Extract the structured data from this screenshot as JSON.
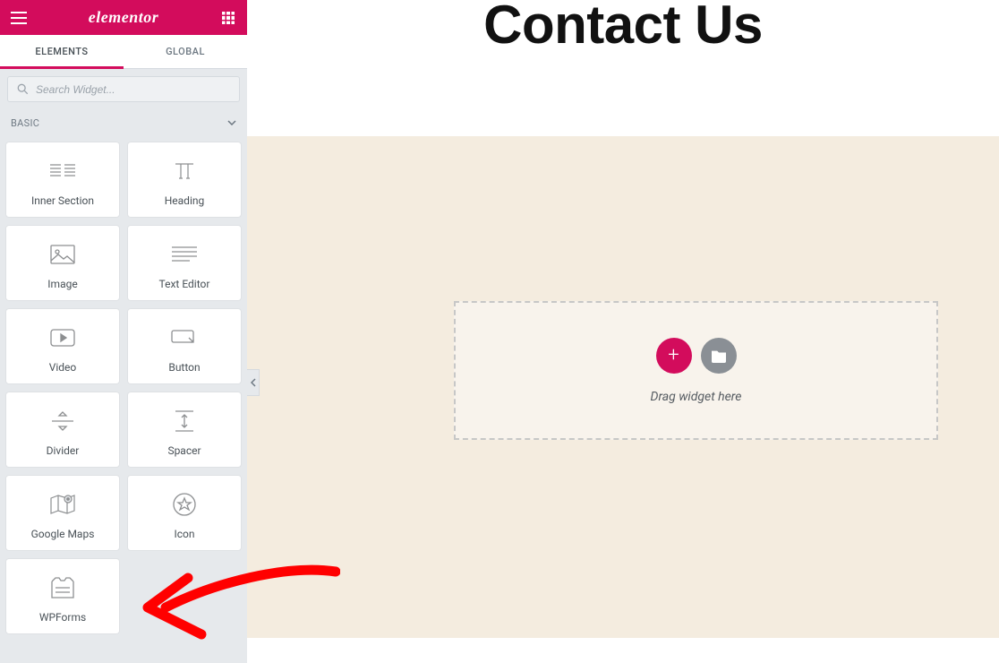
{
  "brand": "elementor",
  "tabs": {
    "elements": "ELEMENTS",
    "global": "GLOBAL"
  },
  "search": {
    "placeholder": "Search Widget..."
  },
  "category": "BASIC",
  "widgets": {
    "inner_section": "Inner Section",
    "heading": "Heading",
    "image": "Image",
    "text_editor": "Text Editor",
    "video": "Video",
    "button": "Button",
    "divider": "Divider",
    "spacer": "Spacer",
    "google_maps": "Google Maps",
    "icon": "Icon",
    "wpforms": "WPForms"
  },
  "page": {
    "title": "Contact Us",
    "drop_hint": "Drag widget here",
    "add_label": "+"
  },
  "colors": {
    "accent": "#d30c5c",
    "canvas": "#f4ecdf"
  }
}
